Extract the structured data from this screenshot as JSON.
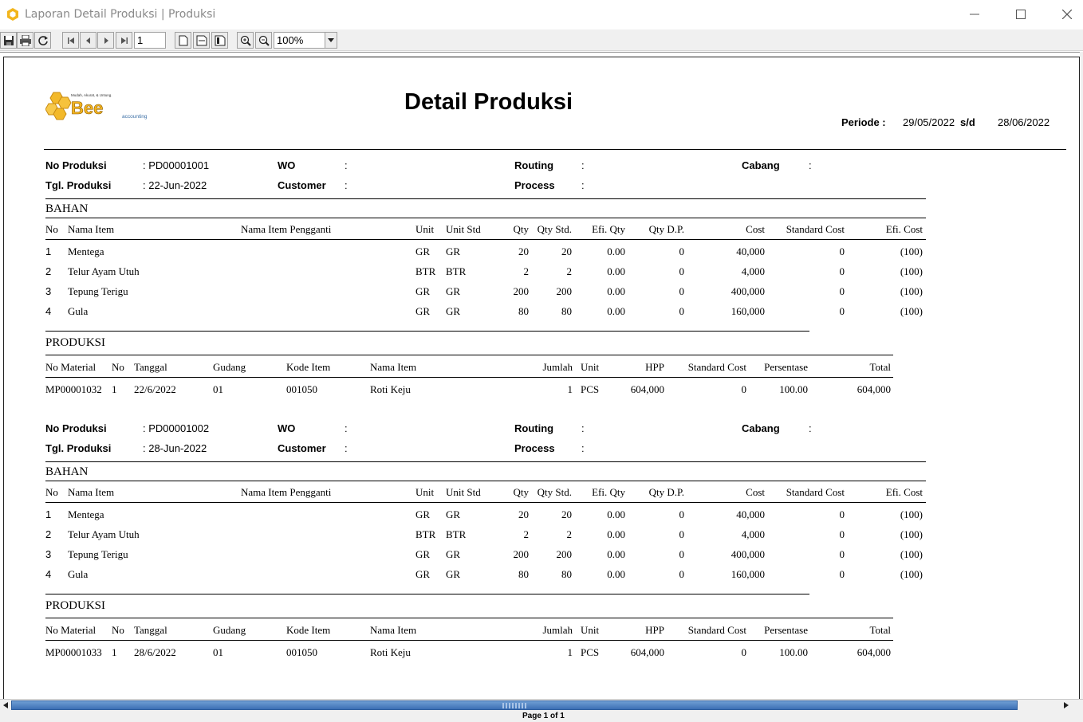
{
  "window": {
    "title": "Laporan Detail Produksi | Produksi"
  },
  "toolbar": {
    "page_number": "1",
    "zoom": "100%"
  },
  "report": {
    "title": "Detail Produksi",
    "logo": {
      "tagline": "Mudah, Akurat, & Untung.",
      "brand": "Bee",
      "sub": "accounting"
    },
    "periode_label": "Periode :",
    "periode_from": "29/05/2022",
    "periode_sd": "s/d",
    "periode_to": "28/06/2022",
    "labels": {
      "no_produksi": "No Produksi",
      "tgl_produksi": "Tgl. Produksi",
      "wo": "WO",
      "customer": "Customer",
      "routing": "Routing",
      "process": "Process",
      "cabang": "Cabang",
      "colon": ":"
    },
    "bahan_title": "BAHAN",
    "produksi_title": "PRODUKSI",
    "bahan_headers": {
      "no": "No",
      "nama_item": "Nama Item",
      "nama_item_pengganti": "Nama Item Pengganti",
      "unit": "Unit",
      "unit_std": "Unit Std",
      "qty": "Qty",
      "qty_std": "Qty Std.",
      "efi_qty": "Efi. Qty",
      "qty_dp": "Qty D.P.",
      "cost": "Cost",
      "standard_cost": "Standard Cost",
      "efi_cost": "Efi. Cost"
    },
    "produksi_headers": {
      "no_material": "No Material",
      "no": "No",
      "tanggal": "Tanggal",
      "gudang": "Gudang",
      "kode_item": "Kode Item",
      "nama_item": "Nama Item",
      "jumlah": "Jumlah",
      "unit": "Unit",
      "hpp": "HPP",
      "standard_cost": "Standard Cost",
      "persentase": "Persentase",
      "total": "Total"
    },
    "groups": [
      {
        "no_produksi": ": PD00001001",
        "tgl_produksi": ": 22-Jun-2022",
        "bahan": [
          {
            "no": "1",
            "nama_item": "Mentega",
            "unit": "GR",
            "unit_std": "GR",
            "qty": "20",
            "qty_std": "20",
            "efi_qty": "0.00",
            "qty_dp": "0",
            "cost": "40,000",
            "standard_cost": "0",
            "efi_cost": "(100)"
          },
          {
            "no": "2",
            "nama_item": "Telur Ayam Utuh",
            "unit": "BTR",
            "unit_std": "BTR",
            "qty": "2",
            "qty_std": "2",
            "efi_qty": "0.00",
            "qty_dp": "0",
            "cost": "4,000",
            "standard_cost": "0",
            "efi_cost": "(100)"
          },
          {
            "no": "3",
            "nama_item": "Tepung Terigu",
            "unit": "GR",
            "unit_std": "GR",
            "qty": "200",
            "qty_std": "200",
            "efi_qty": "0.00",
            "qty_dp": "0",
            "cost": "400,000",
            "standard_cost": "0",
            "efi_cost": "(100)"
          },
          {
            "no": "4",
            "nama_item": "Gula",
            "unit": "GR",
            "unit_std": "GR",
            "qty": "80",
            "qty_std": "80",
            "efi_qty": "0.00",
            "qty_dp": "0",
            "cost": "160,000",
            "standard_cost": "0",
            "efi_cost": "(100)"
          }
        ],
        "produksi": [
          {
            "no_material": "MP00001032",
            "no": "1",
            "tanggal": "22/6/2022",
            "gudang": "01",
            "kode_item": "001050",
            "nama_item": "Roti Keju",
            "jumlah": "1",
            "unit": "PCS",
            "hpp": "604,000",
            "standard_cost": "0",
            "persentase": "100.00",
            "total": "604,000"
          }
        ]
      },
      {
        "no_produksi": ": PD00001002",
        "tgl_produksi": ": 28-Jun-2022",
        "bahan": [
          {
            "no": "1",
            "nama_item": "Mentega",
            "unit": "GR",
            "unit_std": "GR",
            "qty": "20",
            "qty_std": "20",
            "efi_qty": "0.00",
            "qty_dp": "0",
            "cost": "40,000",
            "standard_cost": "0",
            "efi_cost": "(100)"
          },
          {
            "no": "2",
            "nama_item": "Telur Ayam Utuh",
            "unit": "BTR",
            "unit_std": "BTR",
            "qty": "2",
            "qty_std": "2",
            "efi_qty": "0.00",
            "qty_dp": "0",
            "cost": "4,000",
            "standard_cost": "0",
            "efi_cost": "(100)"
          },
          {
            "no": "3",
            "nama_item": "Tepung Terigu",
            "unit": "GR",
            "unit_std": "GR",
            "qty": "200",
            "qty_std": "200",
            "efi_qty": "0.00",
            "qty_dp": "0",
            "cost": "400,000",
            "standard_cost": "0",
            "efi_cost": "(100)"
          },
          {
            "no": "4",
            "nama_item": "Gula",
            "unit": "GR",
            "unit_std": "GR",
            "qty": "80",
            "qty_std": "80",
            "efi_qty": "0.00",
            "qty_dp": "0",
            "cost": "160,000",
            "standard_cost": "0",
            "efi_cost": "(100)"
          }
        ],
        "produksi": [
          {
            "no_material": "MP00001033",
            "no": "1",
            "tanggal": "28/6/2022",
            "gudang": "01",
            "kode_item": "001050",
            "nama_item": "Roti Keju",
            "jumlah": "1",
            "unit": "PCS",
            "hpp": "604,000",
            "standard_cost": "0",
            "persentase": "100.00",
            "total": "604,000"
          }
        ]
      }
    ]
  },
  "status": {
    "page_info": "Page 1 of 1"
  }
}
